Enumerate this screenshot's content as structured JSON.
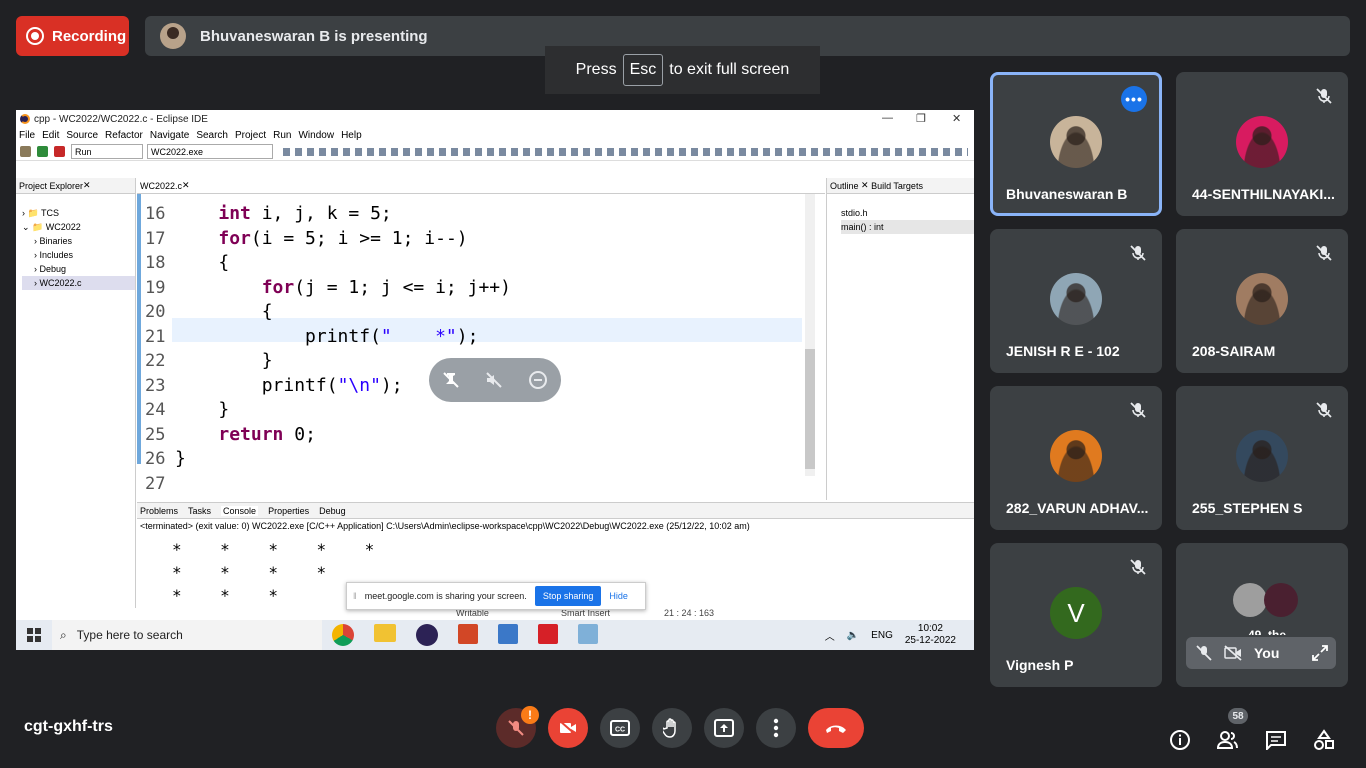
{
  "recording": {
    "label": "Recording"
  },
  "presenter": {
    "banner": "Bhuvaneswaran B is presenting"
  },
  "fullscreen": {
    "press": "Press",
    "key": "Esc",
    "suffix": "to exit full screen"
  },
  "eclipse": {
    "title": "cpp - WC2022/WC2022.c - Eclipse IDE",
    "menu": [
      "File",
      "Edit",
      "Source",
      "Refactor",
      "Navigate",
      "Search",
      "Project",
      "Run",
      "Window",
      "Help"
    ],
    "run_combo": "Run",
    "target_combo": "WC2022.exe",
    "project_explorer_tab": "Project Explorer",
    "tree": [
      "TCS",
      "WC2022",
      "Binaries",
      "Includes",
      "Debug",
      "WC2022.c"
    ],
    "editor_tab": "WC2022.c",
    "outline_tab": "Outline",
    "build_targets_tab": "Build Targets",
    "outline_items": [
      "stdio.h",
      "main() : int"
    ],
    "code_lines": [
      {
        "n": "16",
        "text": "    int i, j, k = 5;"
      },
      {
        "n": "17",
        "text": "    for(i = 5; i >= 1; i--)"
      },
      {
        "n": "18",
        "text": "    {"
      },
      {
        "n": "19",
        "text": "        for(j = 1; j <= i; j++)"
      },
      {
        "n": "20",
        "text": "        {"
      },
      {
        "n": "21",
        "text": "            printf(\"    *\");"
      },
      {
        "n": "22",
        "text": "        }"
      },
      {
        "n": "23",
        "text": "        printf(\"\\n\");"
      },
      {
        "n": "24",
        "text": "    }"
      },
      {
        "n": "25",
        "text": "    return 0;"
      },
      {
        "n": "26",
        "text": "}"
      },
      {
        "n": "27",
        "text": ""
      }
    ],
    "bottom_tabs": [
      "Problems",
      "Tasks",
      "Console",
      "Properties",
      "Debug"
    ],
    "console_header": "<terminated> (exit value: 0) WC2022.exe [C/C++ Application] C:\\Users\\Admin\\eclipse-workspace\\cpp\\WC2022\\Debug\\WC2022.exe (25/12/22, 10:02 am)",
    "console_lines": [
      "*    *    *    *    *",
      "*    *    *    *",
      "*    *    *"
    ],
    "status_writable": "Writable",
    "status_insert": "Smart Insert",
    "status_pos": "21 : 24 : 163"
  },
  "share_notice": {
    "text": "meet.google.com is sharing your screen.",
    "stop": "Stop sharing",
    "hide": "Hide"
  },
  "taskbar": {
    "search": "Type here to search",
    "lang": "ENG",
    "time": "10:02",
    "date": "25-12-2022"
  },
  "participants": [
    {
      "name": "Bhuvaneswaran B",
      "color": "#c8b49a"
    },
    {
      "name": "44-SENTHILNAYAKI...",
      "color": "#d81b60"
    },
    {
      "name": "JENISH R E - 102",
      "color": "#8fa6b5"
    },
    {
      "name": "208-SAIRAM",
      "color": "#a07c62"
    },
    {
      "name": "282_VARUN ADHAV...",
      "color": "#e07a1f"
    },
    {
      "name": "255_STEPHEN S",
      "color": "#34495e"
    },
    {
      "name": "Vignesh P",
      "initial": "V",
      "color": "#33691e"
    },
    {
      "name": "You",
      "color": "#5f6368"
    }
  ],
  "self_tile": {
    "partial": "49_the"
  },
  "meeting": {
    "code": "cgt-gxhf-trs",
    "people_count": "58",
    "alert": "!"
  }
}
